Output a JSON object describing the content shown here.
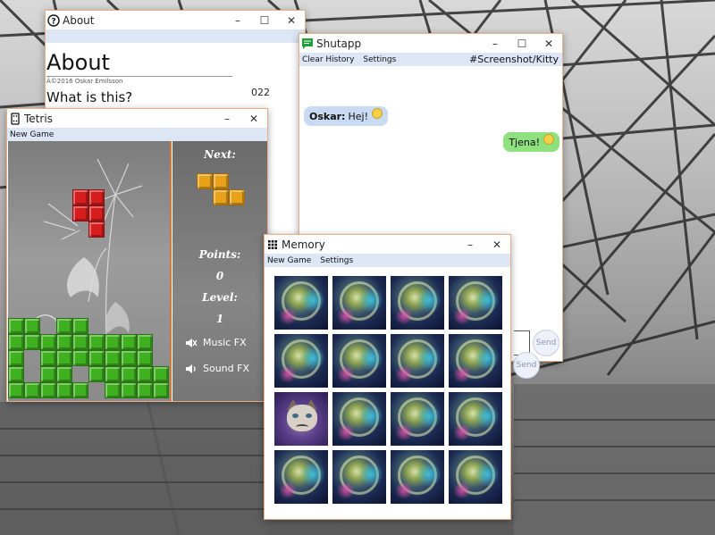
{
  "colors": {
    "menu_bg": "#dce6f5",
    "window_border": "#e8b08a",
    "bubble_in": "#c9dbf2",
    "bubble_out": "#8fe07e",
    "tetris_green": "#3fb01f",
    "tetris_red": "#d61e1e",
    "tetris_orange": "#e8a21a"
  },
  "about": {
    "title": "About",
    "icon": "question-circle-icon",
    "heading": "About",
    "copyright": "Â©2016 Oskar Emilsson",
    "subheading": "What is this?",
    "version_fragment": "022",
    "controls": {
      "minimize": "–",
      "maximize": "☐",
      "close": "✕"
    }
  },
  "shutapp": {
    "title": "Shutapp",
    "icon": "chat-bubble-icon",
    "menu": [
      "Clear History",
      "Settings"
    ],
    "hashtag": "#Screenshot/Kitty",
    "messages": [
      {
        "direction": "incoming",
        "sender": "Oskar:",
        "text": "Hej!"
      },
      {
        "direction": "outgoing",
        "sender": "",
        "text": "Tjena!"
      }
    ],
    "send_label": "Send",
    "send_label_2": "Send",
    "controls": {
      "minimize": "–",
      "maximize": "☐",
      "close": "✕"
    }
  },
  "tetris": {
    "title": "Tetris",
    "icon": "domino-icon",
    "menu": [
      "New Game"
    ],
    "next_label": "Next:",
    "points_label": "Points:",
    "points_value": "0",
    "level_label": "Level:",
    "level_value": "1",
    "music_label": "Music FX",
    "sound_label": "Sound FX",
    "controls": {
      "minimize": "–",
      "close": "✕"
    }
  },
  "memory": {
    "title": "Memory",
    "icon": "grid-icon",
    "menu": [
      "New Game",
      "Settings"
    ],
    "grid_rows": 4,
    "grid_cols": 4,
    "revealed_card": {
      "row": 3,
      "col": 1,
      "image": "grumpy-cat"
    },
    "controls": {
      "minimize": "–",
      "close": "✕"
    }
  }
}
